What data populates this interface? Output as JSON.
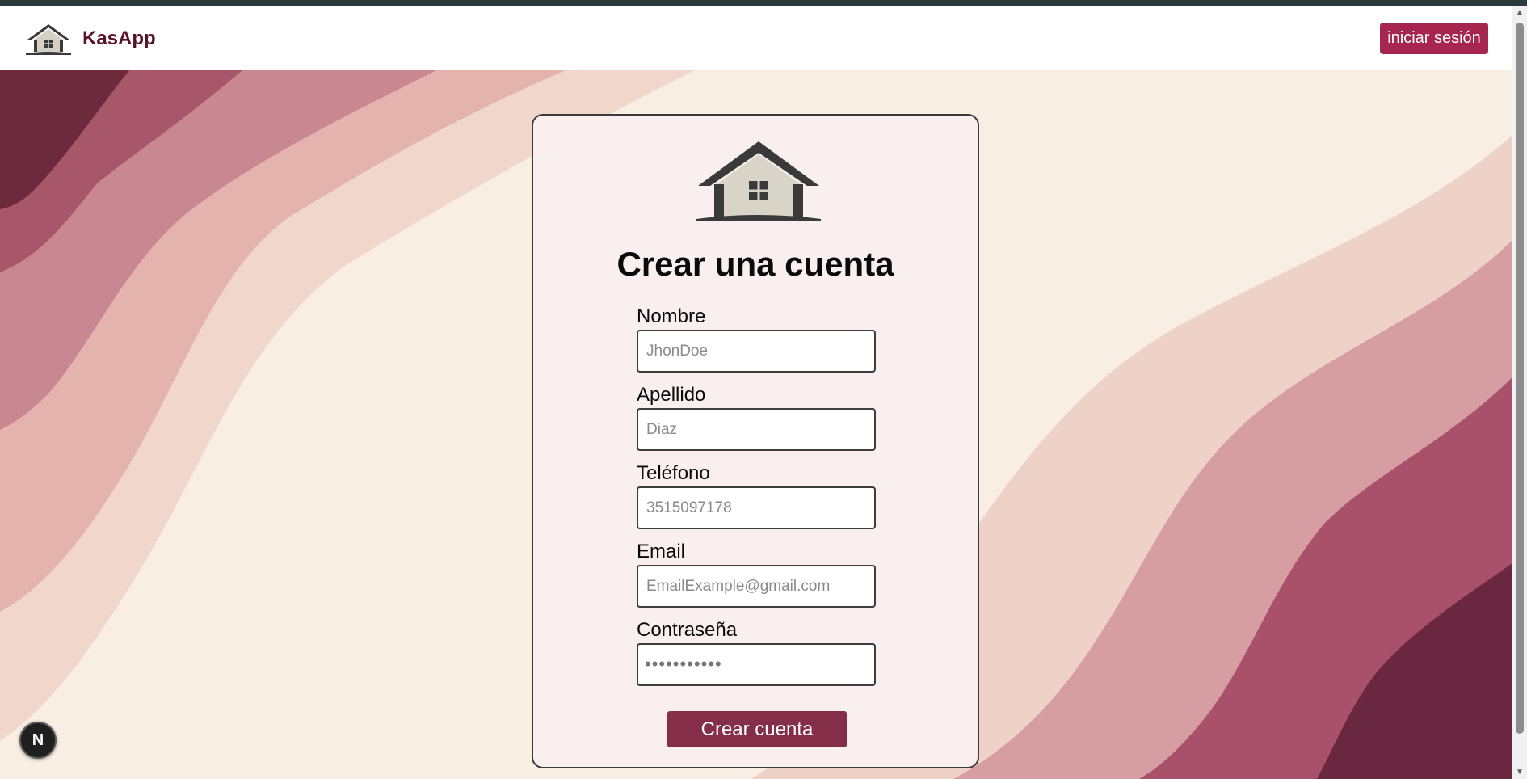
{
  "app": {
    "name": "KasApp"
  },
  "header": {
    "login_label": "iniciar sesión"
  },
  "form": {
    "title": "Crear una cuenta",
    "fields": [
      {
        "label": "Nombre",
        "placeholder": "JhonDoe"
      },
      {
        "label": "Apellido",
        "placeholder": "Diaz"
      },
      {
        "label": "Teléfono",
        "placeholder": "3515097178"
      },
      {
        "label": "Email",
        "placeholder": "EmailExample@gmail.com"
      },
      {
        "label": "Contraseña",
        "value_masked": "•••••••••••"
      }
    ],
    "submit_label": "Crear cuenta"
  },
  "badge": {
    "letter": "N"
  },
  "colors": {
    "brand_text": "#5a1229",
    "login_button": "#a7264f",
    "submit_button": "#852e4a",
    "card_bg": "#f8efee",
    "wave_dark": "#5a1f32",
    "wave_light": "#f9eee3"
  },
  "icons": {
    "logo": "house-icon",
    "scroll_up": "chevron-up-icon",
    "scroll_down": "chevron-down-icon"
  }
}
